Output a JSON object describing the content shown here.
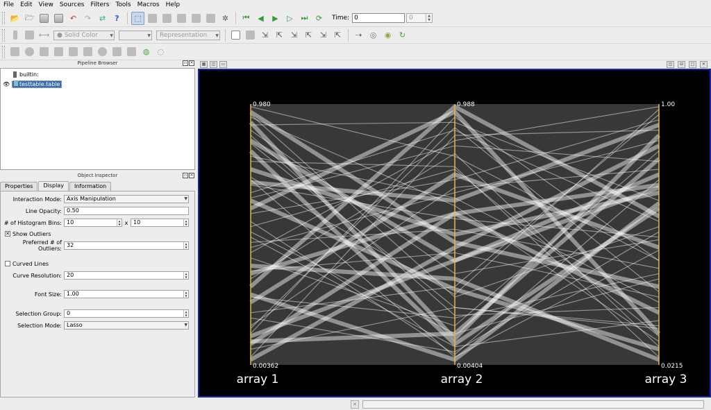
{
  "menu": [
    "File",
    "Edit",
    "View",
    "Sources",
    "Filters",
    "Tools",
    "Macros",
    "Help"
  ],
  "toolbar": {
    "time_label": "Time:",
    "time_value": "0",
    "timestep_value": "0",
    "color_by": "Solid Color",
    "representation": "Representation"
  },
  "pipeline": {
    "title": "Pipeline Browser",
    "root": "builtin:",
    "items": [
      "testtable.table"
    ]
  },
  "inspector": {
    "title": "Object Inspector",
    "tabs": [
      "Properties",
      "Display",
      "Information"
    ],
    "interaction_mode_label": "Interaction Mode:",
    "interaction_mode_value": "Axis Manipulation",
    "line_opacity_label": "Line Opacity:",
    "line_opacity_value": "0.50",
    "hist_bins_label": "# of Histogram Bins:",
    "hist_bins_x": "10",
    "hist_bins_sep": "x",
    "hist_bins_y": "10",
    "show_outliers_label": "Show Outliers",
    "show_outliers_checked": true,
    "preferred_outliers_label": "Preferred # of Outliers:",
    "preferred_outliers_value": "32",
    "curved_lines_label": "Curved Lines",
    "curved_lines_checked": false,
    "curve_resolution_label": "Curve Resolution:",
    "curve_resolution_value": "20",
    "font_size_label": "Font Size:",
    "font_size_value": "1.00",
    "selection_group_label": "Selection Group:",
    "selection_group_value": "0",
    "selection_mode_label": "Selection Mode:",
    "selection_mode_value": "Lasso"
  },
  "chart_data": {
    "type": "parallel-coordinates",
    "axes": [
      {
        "name": "array 1",
        "max_label": "0.980",
        "min_label": "0.00362",
        "max": 0.98,
        "min": 0.00362
      },
      {
        "name": "array 2",
        "max_label": "0.988",
        "min_label": "0.00404",
        "max": 0.988,
        "min": 0.00404
      },
      {
        "name": "array 3",
        "max_label": "1.00",
        "min_label": "0.0215",
        "max": 1.0,
        "min": 0.0215
      }
    ],
    "axis_color": "#e8b84a",
    "line_color": "#ffffff",
    "background": "#000000",
    "samples": [
      [
        0.93,
        0.1,
        0.88
      ],
      [
        0.85,
        0.22,
        0.15
      ],
      [
        0.12,
        0.95,
        0.4
      ],
      [
        0.7,
        0.63,
        0.92
      ],
      [
        0.33,
        0.81,
        0.07
      ],
      [
        0.55,
        0.04,
        0.71
      ],
      [
        0.97,
        0.47,
        0.3
      ],
      [
        0.2,
        0.3,
        0.96
      ],
      [
        0.66,
        0.9,
        0.55
      ],
      [
        0.08,
        0.58,
        0.2
      ],
      [
        0.41,
        0.15,
        0.82
      ],
      [
        0.78,
        0.76,
        0.03
      ],
      [
        0.27,
        0.02,
        0.62
      ],
      [
        0.9,
        0.35,
        0.48
      ],
      [
        0.15,
        0.68,
        0.75
      ],
      [
        0.6,
        0.97,
        0.12
      ],
      [
        0.47,
        0.52,
        0.37
      ],
      [
        0.03,
        0.88,
        0.9
      ],
      [
        0.82,
        0.08,
        0.6
      ],
      [
        0.36,
        0.43,
        0.26
      ],
      [
        0.72,
        0.27,
        0.98
      ],
      [
        0.24,
        0.73,
        0.45
      ],
      [
        0.95,
        0.61,
        0.09
      ],
      [
        0.51,
        0.12,
        0.33
      ],
      [
        0.11,
        0.4,
        0.68
      ],
      [
        0.64,
        0.84,
        0.78
      ],
      [
        0.88,
        0.19,
        0.22
      ],
      [
        0.3,
        0.99,
        0.57
      ],
      [
        0.45,
        0.66,
        0.86
      ],
      [
        0.06,
        0.22,
        0.14
      ],
      [
        0.75,
        0.5,
        0.66
      ],
      [
        0.18,
        0.05,
        0.51
      ],
      [
        0.99,
        0.8,
        0.4
      ],
      [
        0.38,
        0.33,
        0.02
      ],
      [
        0.58,
        0.71,
        0.94
      ],
      [
        0.14,
        0.91,
        0.28
      ],
      [
        0.86,
        0.4,
        0.73
      ],
      [
        0.49,
        0.07,
        0.17
      ],
      [
        0.69,
        0.56,
        0.49
      ],
      [
        0.02,
        0.45,
        0.84
      ],
      [
        0.92,
        0.93,
        0.63
      ],
      [
        0.26,
        0.18,
        0.35
      ],
      [
        0.63,
        0.29,
        0.06
      ],
      [
        0.43,
        0.86,
        0.99
      ],
      [
        0.8,
        0.64,
        0.24
      ],
      [
        0.09,
        0.12,
        0.79
      ],
      [
        0.53,
        0.75,
        0.11
      ],
      [
        0.96,
        0.26,
        0.53
      ],
      [
        0.35,
        0.58,
        0.69
      ],
      [
        0.71,
        0.03,
        0.44
      ]
    ]
  }
}
